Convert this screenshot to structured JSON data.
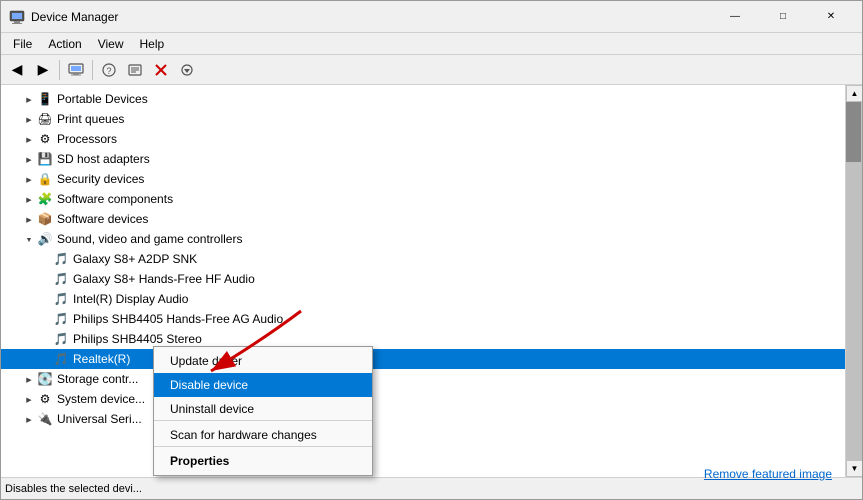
{
  "window": {
    "title": "Device Manager",
    "icon": "device-manager-icon"
  },
  "menu": {
    "items": [
      "File",
      "Action",
      "View",
      "Help"
    ]
  },
  "toolbar": {
    "buttons": [
      {
        "id": "back",
        "label": "◀",
        "disabled": false
      },
      {
        "id": "forward",
        "label": "▶",
        "disabled": false
      },
      {
        "id": "up",
        "label": "↑",
        "disabled": true
      },
      {
        "id": "computer",
        "label": "🖥",
        "disabled": false
      },
      {
        "id": "refresh",
        "label": "🔄",
        "disabled": false
      },
      {
        "id": "help",
        "label": "?",
        "disabled": false
      },
      {
        "id": "scan",
        "label": "🔍",
        "disabled": false
      },
      {
        "id": "properties",
        "label": "⚡",
        "disabled": false
      },
      {
        "id": "remove",
        "label": "✖",
        "disabled": false
      },
      {
        "id": "update",
        "label": "⬇",
        "disabled": false
      }
    ]
  },
  "tree": {
    "items": [
      {
        "id": "portable",
        "label": "Portable Devices",
        "indent": 1,
        "expander": "right",
        "icon": "portable",
        "expanded": false
      },
      {
        "id": "print-queues",
        "label": "Print queues",
        "indent": 1,
        "expander": "right",
        "icon": "printer",
        "expanded": false
      },
      {
        "id": "processors",
        "label": "Processors",
        "indent": 1,
        "expander": "right",
        "icon": "cpu",
        "expanded": false
      },
      {
        "id": "sd-host",
        "label": "SD host adapters",
        "indent": 1,
        "expander": "right",
        "icon": "card",
        "expanded": false
      },
      {
        "id": "security",
        "label": "Security devices",
        "indent": 1,
        "expander": "right",
        "icon": "shield",
        "expanded": false
      },
      {
        "id": "software-comp",
        "label": "Software components",
        "indent": 1,
        "expander": "right",
        "icon": "puzzle",
        "expanded": false
      },
      {
        "id": "software-dev",
        "label": "Software devices",
        "indent": 1,
        "expander": "right",
        "icon": "device",
        "expanded": false
      },
      {
        "id": "sound",
        "label": "Sound, video and game controllers",
        "indent": 1,
        "expander": "down",
        "icon": "sound",
        "expanded": true
      },
      {
        "id": "galaxy-a2dp",
        "label": "Galaxy S8+ A2DP SNK",
        "indent": 2,
        "expander": "none",
        "icon": "audio",
        "expanded": false
      },
      {
        "id": "galaxy-hf",
        "label": "Galaxy S8+ Hands-Free HF Audio",
        "indent": 2,
        "expander": "none",
        "icon": "audio",
        "expanded": false
      },
      {
        "id": "intel-display",
        "label": "Intel(R) Display Audio",
        "indent": 2,
        "expander": "none",
        "icon": "audio",
        "expanded": false
      },
      {
        "id": "philips-ag",
        "label": "Philips SHB4405 Hands-Free AG Audio",
        "indent": 2,
        "expander": "none",
        "icon": "audio",
        "expanded": false
      },
      {
        "id": "philips-stereo",
        "label": "Philips SHB4405 Stereo",
        "indent": 2,
        "expander": "none",
        "icon": "audio",
        "expanded": false
      },
      {
        "id": "realtek",
        "label": "Realtek(R)",
        "indent": 2,
        "expander": "none",
        "icon": "audio",
        "expanded": false,
        "selected": true
      },
      {
        "id": "storage",
        "label": "Storage contr...",
        "indent": 1,
        "expander": "right",
        "icon": "storage",
        "expanded": false
      },
      {
        "id": "system",
        "label": "System device...",
        "indent": 1,
        "expander": "right",
        "icon": "sys",
        "expanded": false
      },
      {
        "id": "universal",
        "label": "Universal Seri...",
        "indent": 1,
        "expander": "right",
        "icon": "usb",
        "expanded": false
      }
    ]
  },
  "context_menu": {
    "items": [
      {
        "id": "update-driver",
        "label": "Update driver",
        "highlighted": false,
        "bold": false,
        "separator_below": false
      },
      {
        "id": "disable-device",
        "label": "Disable device",
        "highlighted": true,
        "bold": false,
        "separator_below": false
      },
      {
        "id": "uninstall-device",
        "label": "Uninstall device",
        "highlighted": false,
        "bold": false,
        "separator_below": true
      },
      {
        "id": "scan-changes",
        "label": "Scan for hardware changes",
        "highlighted": false,
        "bold": false,
        "separator_below": true
      },
      {
        "id": "properties",
        "label": "Properties",
        "highlighted": false,
        "bold": true,
        "separator_below": false
      }
    ]
  },
  "status_bar": {
    "text": "Disables the selected devi..."
  },
  "remove_featured_image": {
    "label": "Remove featured image"
  },
  "title_buttons": {
    "minimize": "—",
    "maximize": "□",
    "close": "✕"
  }
}
